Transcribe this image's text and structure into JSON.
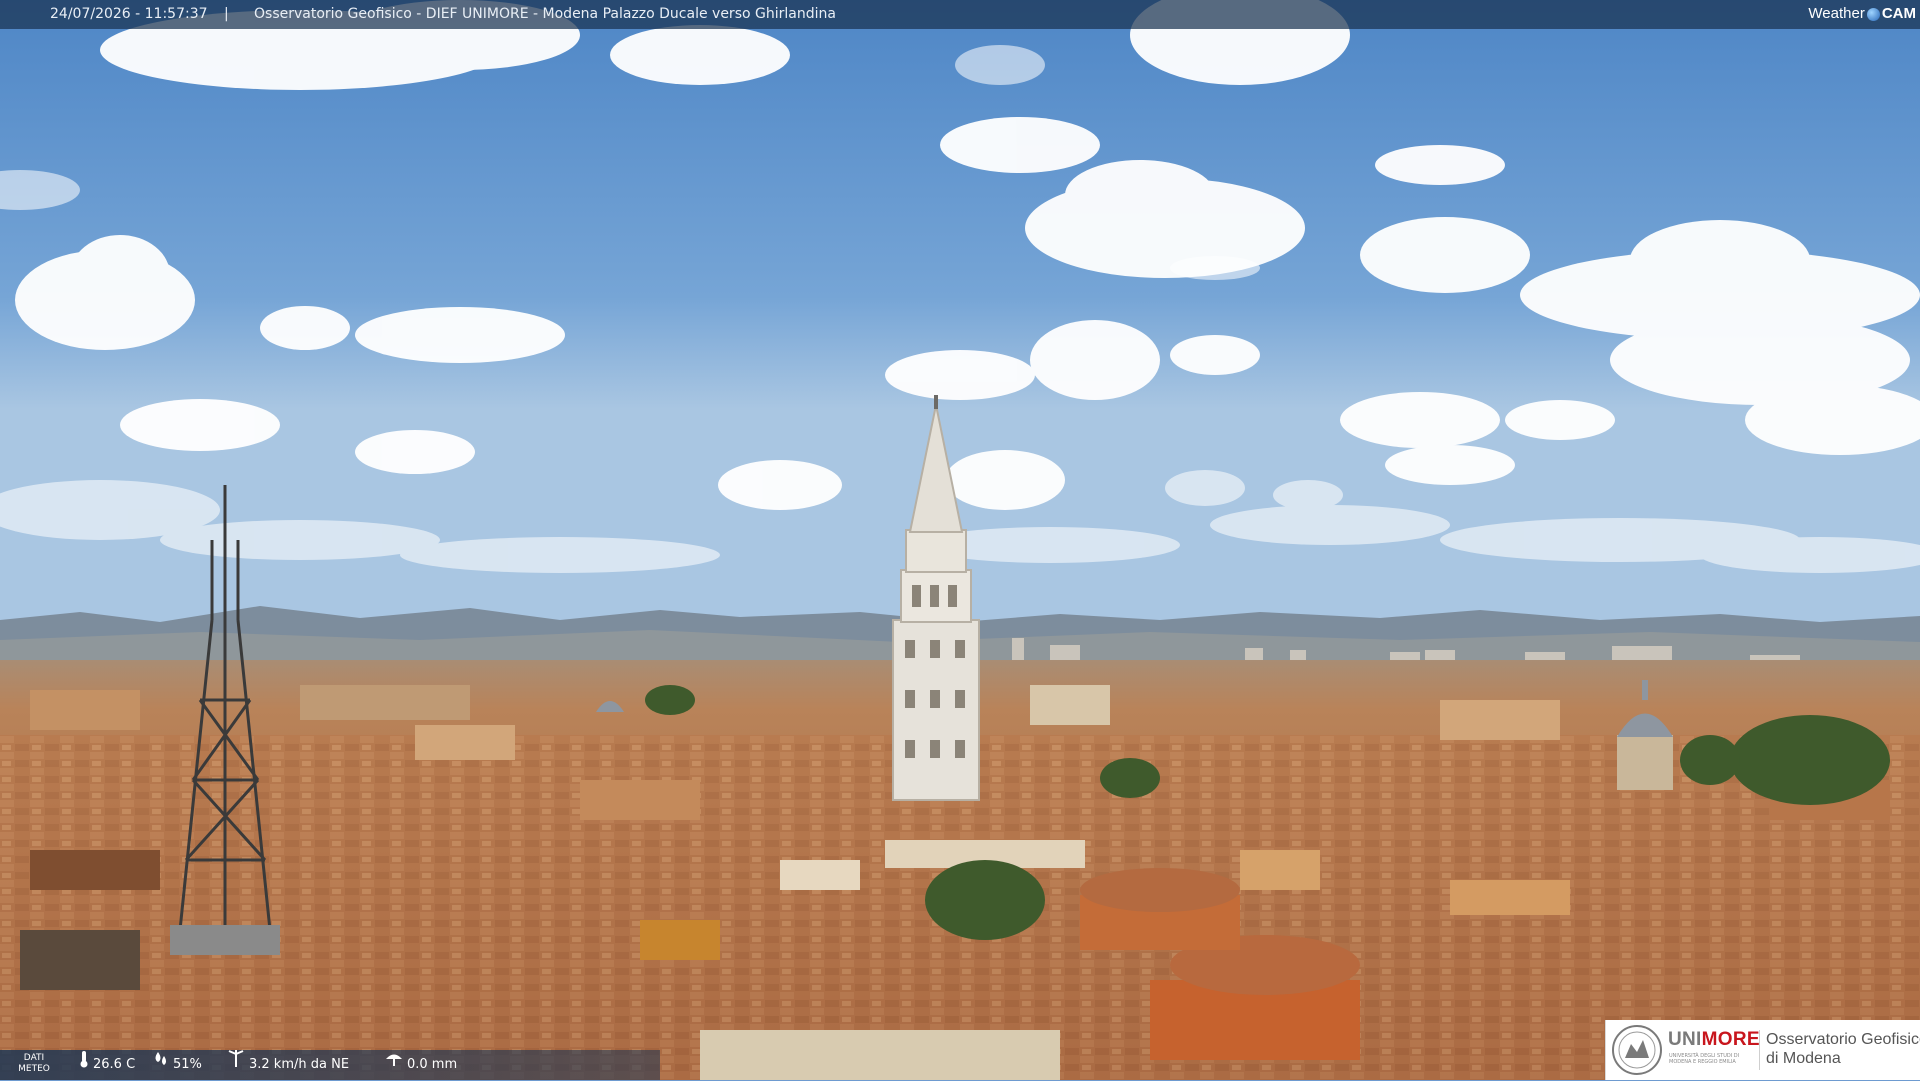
{
  "header": {
    "timestamp": "24/07/2026 - 11:57:37",
    "separator": "|",
    "title": "Osservatorio Geofisico - DIEF UNIMORE - Modena Palazzo Ducale verso Ghirlandina",
    "brand_word1": "Weather",
    "brand_word2": "CAM",
    "brand_icon": "globe-icon"
  },
  "weather": {
    "label_line1": "DATI",
    "label_line2": "METEO",
    "temperature": "26.6 C",
    "temperature_icon": "thermometer-icon",
    "humidity": "51%",
    "humidity_icon": "droplets-icon",
    "wind": "3.2 km/h da NE",
    "wind_icon": "wind-icon",
    "rain": "0.0 mm",
    "rain_icon": "rain-icon"
  },
  "logo": {
    "uni_part1": "UNI",
    "uni_part2": "MORE",
    "uni_sub": "UNIVERSITÀ DEGLI STUDI DI MODENA E REGGIO EMILIA",
    "observatory_line1": "Osservatorio Geofisico",
    "observatory_line2": "di Modena",
    "accent_color": "#c8161d"
  },
  "scene": {
    "sky_color": "#6e9bd0",
    "roof_color": "#b5764a"
  }
}
